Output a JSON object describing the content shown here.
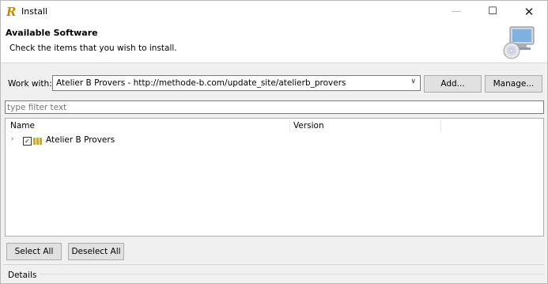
{
  "window": {
    "title": "Install",
    "minimize_glyph": "—",
    "maximize_glyph": "☐",
    "close_glyph": "✕"
  },
  "header": {
    "title": "Available Software",
    "description": "Check the items that you wish to install."
  },
  "work_with": {
    "label": "Work with:",
    "value": "Atelier B Provers - http://methode-b.com/update_site/atelierb_provers",
    "dropdown_glyph": "∨",
    "add_label": "Add...",
    "manage_label": "Manage..."
  },
  "filter": {
    "placeholder": "type filter text"
  },
  "table": {
    "columns": [
      "Name",
      "Version"
    ],
    "rows": [
      {
        "label": "Atelier B Provers",
        "version": "",
        "checked": true,
        "expanded": false
      }
    ],
    "expand_glyph": "›",
    "check_glyph": "✓"
  },
  "actions": {
    "select_all_label": "Select All",
    "deselect_all_label": "Deselect All"
  },
  "details": {
    "label": "Details"
  },
  "colors": {
    "accent": "#c98a00",
    "background": "#f0f0f0",
    "button": "#e1e1e1"
  }
}
